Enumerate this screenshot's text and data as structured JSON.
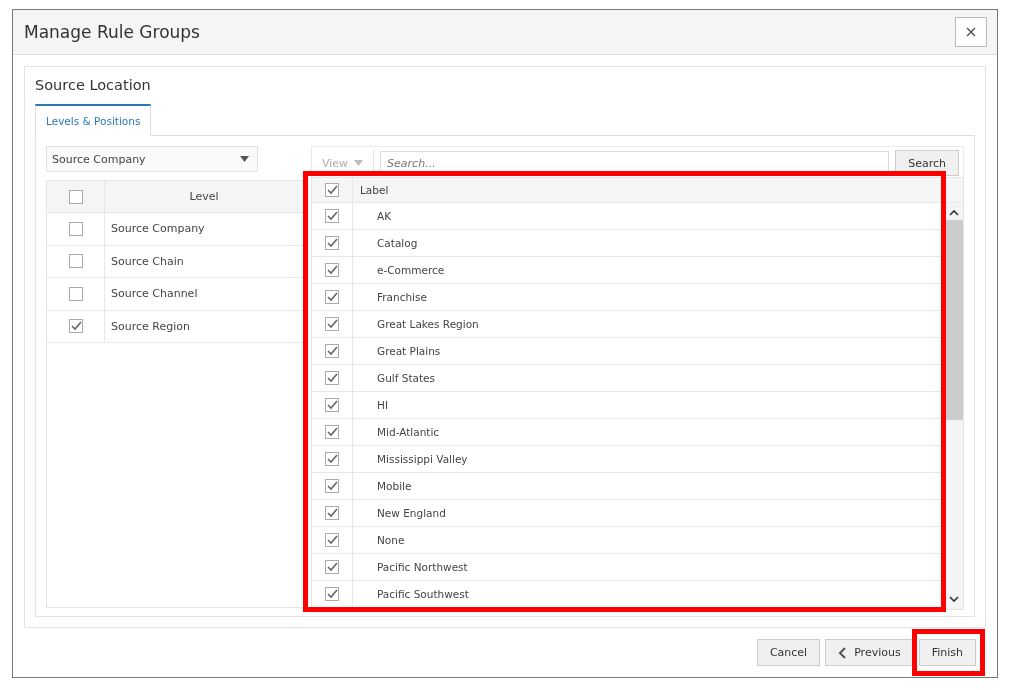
{
  "window": {
    "title": "Manage Rule Groups"
  },
  "section_title": "Source Location",
  "tabs": [
    {
      "label": "Levels & Positions",
      "selected": true
    }
  ],
  "level_select": {
    "value": "Source Company"
  },
  "levels_table": {
    "select_all_checked": false,
    "column": "Level",
    "rows": [
      {
        "label": "Source Company",
        "checked": false
      },
      {
        "label": "Source Chain",
        "checked": false
      },
      {
        "label": "Source Channel",
        "checked": false
      },
      {
        "label": "Source Region",
        "checked": true
      }
    ]
  },
  "view_menu": {
    "label": "View"
  },
  "search": {
    "placeholder": "Search...",
    "button": "Search"
  },
  "positions_table": {
    "select_all_checked": true,
    "column": "Label",
    "rows": [
      {
        "label": "AK",
        "checked": true
      },
      {
        "label": "Catalog",
        "checked": true
      },
      {
        "label": "e-Commerce",
        "checked": true
      },
      {
        "label": "Franchise",
        "checked": true
      },
      {
        "label": "Great Lakes Region",
        "checked": true
      },
      {
        "label": "Great Plains",
        "checked": true
      },
      {
        "label": "Gulf States",
        "checked": true
      },
      {
        "label": "HI",
        "checked": true
      },
      {
        "label": "Mid-Atlantic",
        "checked": true
      },
      {
        "label": "Mississippi Valley",
        "checked": true
      },
      {
        "label": "Mobile",
        "checked": true
      },
      {
        "label": "New England",
        "checked": true
      },
      {
        "label": "None",
        "checked": true
      },
      {
        "label": "Pacific Northwest",
        "checked": true
      },
      {
        "label": "Pacific Southwest",
        "checked": true
      }
    ]
  },
  "footer_buttons": [
    {
      "label": "Cancel",
      "kind": "plain",
      "highlighted": false
    },
    {
      "label": "Previous",
      "kind": "back",
      "highlighted": false
    },
    {
      "label": "Finish",
      "kind": "plain",
      "highlighted": true
    }
  ]
}
